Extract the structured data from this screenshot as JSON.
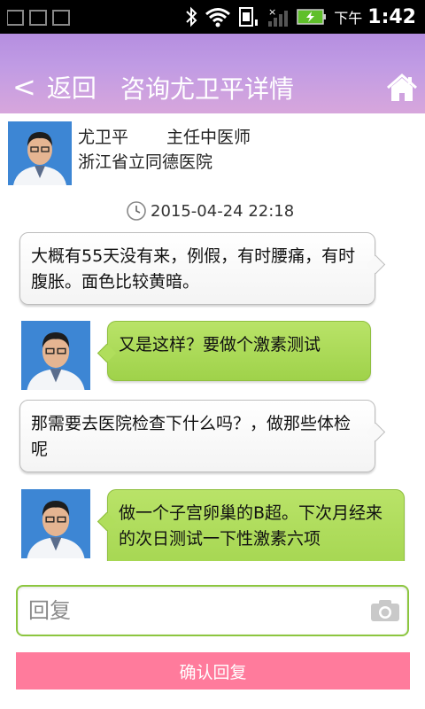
{
  "status_bar": {
    "ampm": "下午",
    "time": "1:42",
    "icons": [
      "image-icon",
      "image-icon",
      "image-icon",
      "bluetooth-icon",
      "wifi-icon",
      "sim-card-icon",
      "signal-icon",
      "battery-charging-icon"
    ]
  },
  "header": {
    "back_label": "返回",
    "title": "咨询尤卫平详情",
    "home_icon": "home-icon"
  },
  "doctor": {
    "name": "尤卫平",
    "title": "主任中医师",
    "hospital": "浙江省立同德医院"
  },
  "timestamp": "2015-04-24 22:18",
  "messages": [
    {
      "side": "patient",
      "text": "大概有55天没有来，例假，有时腰痛，有时腹胀。面色比较黄暗。"
    },
    {
      "side": "doctor",
      "text": "又是这样？要做个激素测试"
    },
    {
      "side": "patient",
      "text": "那需要去医院检查下什么吗？，做那些体检呢"
    },
    {
      "side": "doctor",
      "text": "做一个子宫卵巢的B超。下次月经来的次日测试一下性激素六项"
    }
  ],
  "reply": {
    "placeholder": "回复",
    "confirm_label": "确认回复"
  },
  "colors": {
    "header_gradient_start": "#b58ee0",
    "header_gradient_end": "#d7a6dc",
    "doctor_bubble": "#a8d654",
    "input_border": "#8cc63f",
    "confirm_button": "#ff7b9c"
  }
}
